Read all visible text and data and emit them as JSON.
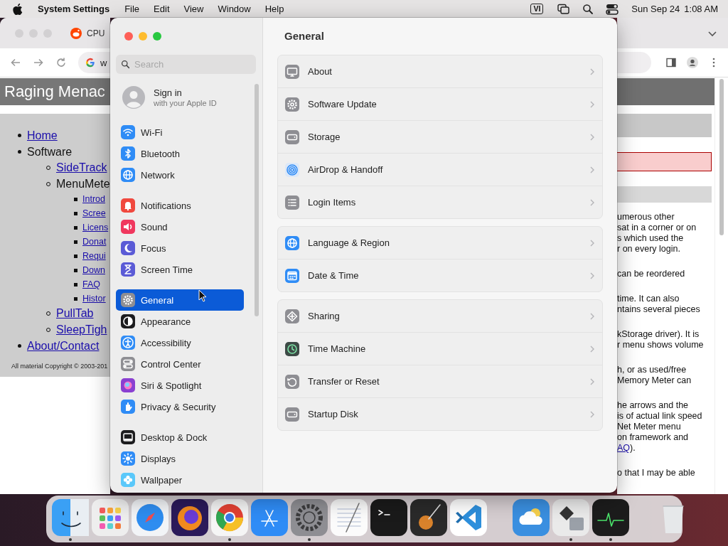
{
  "menu_bar": {
    "app_name": "System Settings",
    "menus": [
      "File",
      "Edit",
      "View",
      "Window",
      "Help"
    ],
    "input_source": "VI",
    "date": "Sun Sep 24",
    "time": "1:08 AM"
  },
  "browser": {
    "tab_title": "CPU",
    "address": "w",
    "page_title": "Raging Menac",
    "nav": [
      {
        "label": "Home",
        "link": true
      },
      {
        "label": "Software",
        "link": false,
        "children": [
          {
            "label": "SideTrack",
            "link": true
          },
          {
            "label": "MenuMete",
            "link": false,
            "children": [
              {
                "label": "Introd",
                "link": true
              },
              {
                "label": "Scree",
                "link": true
              },
              {
                "label": "Licens",
                "link": true
              },
              {
                "label": "Donat",
                "link": true
              },
              {
                "label": "Requi",
                "link": true
              },
              {
                "label": "Down",
                "link": true
              },
              {
                "label": "FAQ",
                "link": true
              },
              {
                "label": "Histor",
                "link": true
              }
            ]
          },
          {
            "label": "PullTab",
            "link": true
          },
          {
            "label": "SleepTigh",
            "link": true
          }
        ]
      },
      {
        "label": "About/Contact",
        "link": true
      }
    ],
    "copyright": "All material Copyright © 2003-201",
    "paragraphs": [
      [
        {
          "text": "umerous other"
        },
        {
          "text": "sat in a corner or on"
        },
        {
          "text": "s which used the"
        },
        {
          "text": "r on every login."
        }
      ],
      [
        {
          "text": "can be reordered"
        }
      ],
      [
        {
          "text": "time. It can also"
        },
        {
          "text": "ntains several pieces"
        }
      ],
      [
        {
          "text": "kStorage driver). It is"
        },
        {
          "text": "r menu shows volume"
        }
      ],
      [
        {
          "text": "h, or as used/free"
        },
        {
          "text": "Memory Meter can"
        }
      ],
      [
        {
          "text": "he arrows and the"
        },
        {
          "text": "is of actual link speed"
        },
        {
          "text": "Net Meter menu"
        },
        {
          "text": "on framework and"
        },
        {
          "link": "AQ",
          "text": ")."
        }
      ],
      [
        {
          "text": "o that I may be able"
        }
      ]
    ]
  },
  "settings": {
    "sidebar": {
      "search": {
        "placeholder": "Search"
      },
      "account": {
        "title": "Sign in",
        "subtitle": "with your Apple ID"
      },
      "groups": [
        {
          "items": [
            {
              "label": "Wi-Fi",
              "color": "#2f8cf6",
              "selected": false
            },
            {
              "label": "Bluetooth",
              "color": "#2f8cf6",
              "selected": false
            },
            {
              "label": "Network",
              "color": "#2f8cf6",
              "selected": false
            }
          ]
        },
        {
          "items": [
            {
              "label": "Notifications",
              "color": "#f0483e",
              "selected": false
            },
            {
              "label": "Sound",
              "color": "#f0385e",
              "selected": false
            },
            {
              "label": "Focus",
              "color": "#5b5bd6",
              "selected": false
            },
            {
              "label": "Screen Time",
              "color": "#5b5bd6",
              "selected": false
            }
          ]
        },
        {
          "items": [
            {
              "label": "General",
              "color": "#8e8e93",
              "selected": true
            },
            {
              "label": "Appearance",
              "color": "#1c1c1e",
              "selected": false
            },
            {
              "label": "Accessibility",
              "color": "#2f8cf6",
              "selected": false
            },
            {
              "label": "Control Center",
              "color": "#8e8e93",
              "selected": false
            },
            {
              "label": "Siri & Spotlight",
              "color": "#8a3fd1",
              "selected": false
            },
            {
              "label": "Privacy & Security",
              "color": "#2f8cf6",
              "selected": false
            }
          ]
        },
        {
          "items": [
            {
              "label": "Desktop & Dock",
              "color": "#1c1c1e",
              "selected": false
            },
            {
              "label": "Displays",
              "color": "#2f8cf6",
              "selected": false
            },
            {
              "label": "Wallpaper",
              "color": "#5ac8fa",
              "selected": false
            }
          ]
        }
      ]
    },
    "title": "General",
    "groups": [
      {
        "items": [
          {
            "label": "About",
            "color": "#8e8e93"
          },
          {
            "label": "Software Update",
            "color": "#8e8e93"
          },
          {
            "label": "Storage",
            "color": "#8e8e93"
          },
          {
            "label": "AirDrop & Handoff",
            "color": "#dce8f8"
          },
          {
            "label": "Login Items",
            "color": "#8e8e93"
          }
        ]
      },
      {
        "items": [
          {
            "label": "Language & Region",
            "color": "#2f8cf6"
          },
          {
            "label": "Date & Time",
            "color": "#2f8cf6"
          }
        ]
      },
      {
        "items": [
          {
            "label": "Sharing",
            "color": "#8e8e93"
          },
          {
            "label": "Time Machine",
            "color": "#3d4a46"
          },
          {
            "label": "Transfer or Reset",
            "color": "#8e8e93"
          },
          {
            "label": "Startup Disk",
            "color": "#8e8e93"
          }
        ]
      }
    ]
  },
  "dock": {
    "items": [
      {
        "running": true
      },
      {
        "running": false
      },
      {
        "running": false
      },
      {
        "running": false
      },
      {
        "running": true
      },
      {
        "running": false
      },
      {
        "running": true
      },
      {
        "running": false
      },
      {
        "running": false
      },
      {
        "running": false
      },
      {
        "running": false
      },
      {
        "running": false
      },
      {
        "running": true
      },
      {
        "running": true
      },
      {
        "running": false
      }
    ]
  }
}
